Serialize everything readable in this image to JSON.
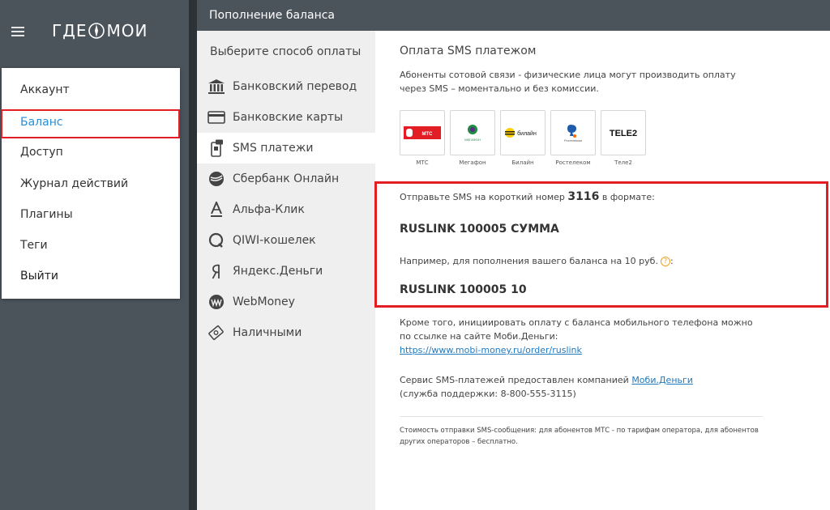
{
  "app": {
    "logo_left": "ГДЕ",
    "logo_right": "МОИ"
  },
  "menu": {
    "items": [
      {
        "label": "Аккаунт"
      },
      {
        "label": "Баланс"
      },
      {
        "label": "Доступ"
      },
      {
        "label": "Журнал действий"
      },
      {
        "label": "Плагины"
      },
      {
        "label": "Теги"
      },
      {
        "label": "Выйти"
      }
    ],
    "active": "Баланс"
  },
  "header": {
    "title": "Пополнение баланса"
  },
  "methods": {
    "heading": "Выберите способ оплаты",
    "items": [
      {
        "label": "Банковский перевод",
        "icon": "bank-icon"
      },
      {
        "label": "Банковские карты",
        "icon": "card-icon"
      },
      {
        "label": "SMS платежи",
        "icon": "sms-phone-icon"
      },
      {
        "label": "Сбербанк Онлайн",
        "icon": "sberbank-icon"
      },
      {
        "label": "Альфа-Клик",
        "icon": "alfa-icon"
      },
      {
        "label": "QIWI-кошелек",
        "icon": "qiwi-icon"
      },
      {
        "label": "Яндекс.Деньги",
        "icon": "yandex-icon"
      },
      {
        "label": "WebMoney",
        "icon": "webmoney-icon"
      },
      {
        "label": "Наличными",
        "icon": "cash-icon"
      }
    ],
    "active": "SMS платежи"
  },
  "content": {
    "title": "Оплата SMS платежом",
    "intro": "Абоненты сотовой связи - физические лица могут производить оплату через SMS – моментально и без комиссии.",
    "operators": [
      {
        "name": "МТС",
        "logo_text": "МТС"
      },
      {
        "name": "Мегафон",
        "logo_text": "МЕГАФОН"
      },
      {
        "name": "Билайн",
        "logo_text": "билайн"
      },
      {
        "name": "Ростелеком",
        "logo_text": "Ростелеком"
      },
      {
        "name": "Теле2",
        "logo_text": "TELE2"
      }
    ],
    "sms_prefix": "Отправьте SMS на короткий номер",
    "sms_number": "3116",
    "sms_suffix": "в формате:",
    "command": "RUSLINK 100005 СУММА",
    "example": "Например, для пополнения вашего баланса на 10 руб.",
    "help_mark": "?",
    "example_colon": ":",
    "command_example": "RUSLINK 100005 10",
    "alt_text": "Кроме того, инициировать оплату с баланса мобильного телефона можно по ссылке на сайте Моби.Деньги:",
    "alt_link": "https://www.mobi-money.ru/order/ruslink",
    "provider_text": "Сервис SMS-платежей предоставлен компанией",
    "provider_link": "Моби.Деньги",
    "support": "(служба поддержки: 8-800-555-3115)",
    "footnote": "Стоимость отправки SMS-сообщения: для абонентов МТС - по тарифам оператора, для абонентов других операторов – бесплатно."
  },
  "colors": {
    "sidebar": "#4b535b",
    "accent": "#2a8ed6",
    "highlight": "#e31d24",
    "link": "#1f7ac0"
  }
}
